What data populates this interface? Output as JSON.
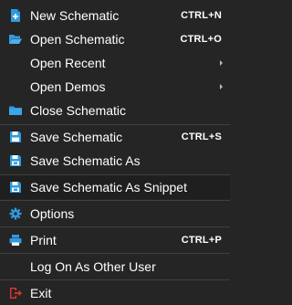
{
  "colors": {
    "background": "#252525",
    "highlight": "#1f1f1f",
    "separator": "#3f3f3f",
    "text": "#ffffff",
    "icon_blue": "#2f9bdf",
    "icon_red": "#e3342f"
  },
  "menu": {
    "items": [
      {
        "label": "New Schematic",
        "shortcut": "CTRL+N",
        "icon": "new-file-icon"
      },
      {
        "label": "Open Schematic",
        "shortcut": "CTRL+O",
        "icon": "folder-open-icon"
      },
      {
        "label": "Open Recent",
        "submenu": true
      },
      {
        "label": "Open Demos",
        "submenu": true
      },
      {
        "label": "Close Schematic",
        "icon": "folder-icon"
      },
      {
        "label": "Save Schematic",
        "shortcut": "CTRL+S",
        "icon": "save-icon"
      },
      {
        "label": "Save Schematic As",
        "icon": "save-as-icon"
      },
      {
        "label": "Save Schematic As Snippet",
        "icon": "save-snippet-icon"
      },
      {
        "label": "Options",
        "icon": "gear-icon"
      },
      {
        "label": "Print",
        "shortcut": "CTRL+P",
        "icon": "printer-icon"
      },
      {
        "label": "Log On As Other User"
      },
      {
        "label": "Exit",
        "icon": "exit-icon"
      }
    ]
  }
}
